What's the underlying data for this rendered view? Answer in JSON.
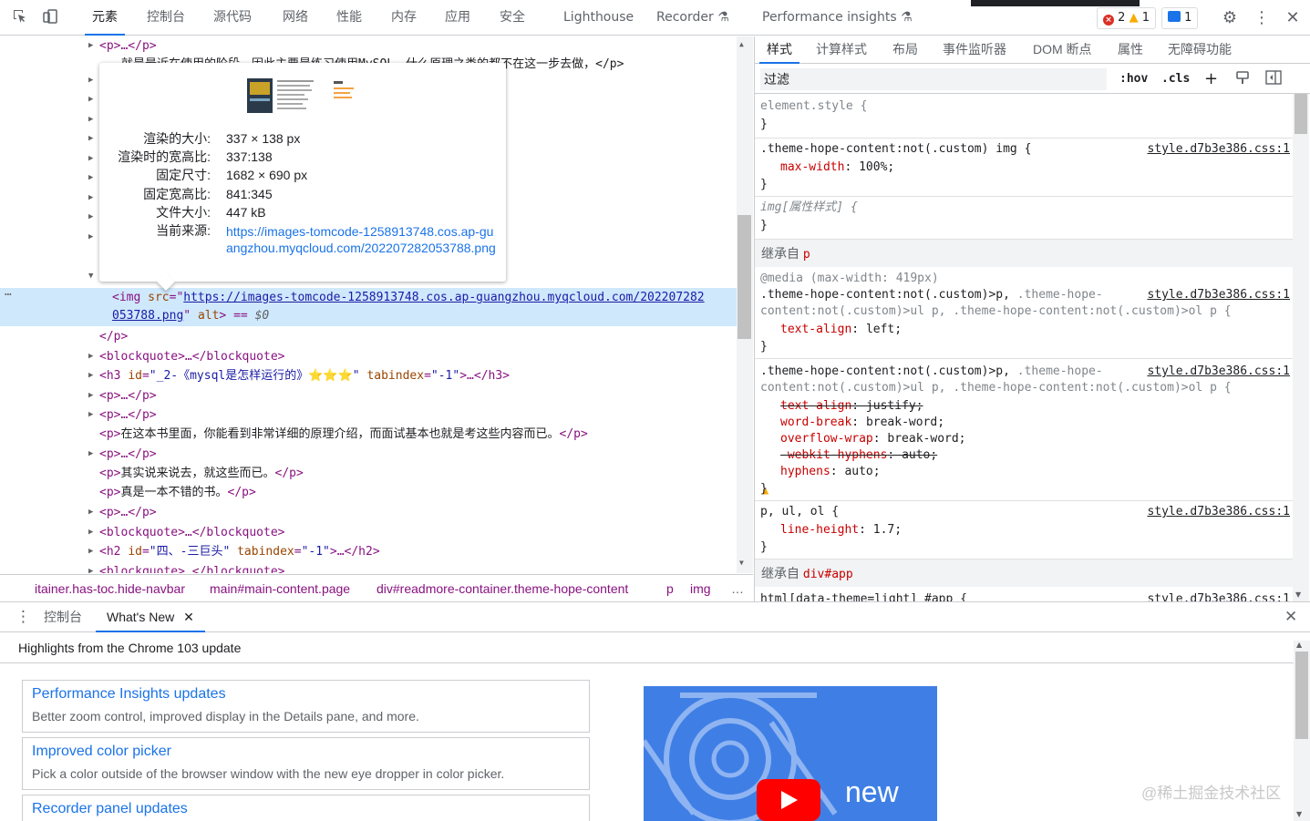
{
  "topbar": {
    "tabs": [
      "元素",
      "控制台",
      "源代码",
      "网络",
      "性能",
      "内存",
      "应用",
      "安全",
      "Lighthouse",
      "Recorder",
      "Performance insights"
    ],
    "errors": "2",
    "warnings": "1",
    "messages": "1"
  },
  "elements": {
    "lines": [
      "<p>…</p>",
      "就是最近在使用的阶段。因此主要是练习使用MySQL，什么原理之类的都不在这一步去做，</p>"
    ],
    "selected": {
      "tag_open": "<img",
      "attr_src": "src",
      "src_value_1": "https://images-tomcode-1258913748.cos.ap-guangzhou.myqcloud.com/202207282",
      "src_value_2": "053788.png",
      "attr_alt": "alt",
      "tail": "> == ",
      "var": "$0"
    },
    "after": [
      {
        "kind": "close",
        "text": "</p>"
      },
      {
        "kind": "collapsed",
        "text": "<blockquote>…</blockquote>"
      },
      {
        "kind": "h3",
        "tag": "<h3 ",
        "id_attr": "id",
        "id_val": "\"_2-《mysql是怎样运行的》⭐⭐⭐\"",
        "tab_attr": "tabindex",
        "tab_val": "\"-1\"",
        "tail": ">…</h3>"
      },
      {
        "kind": "collapsed",
        "text": "<p>…</p>"
      },
      {
        "kind": "collapsed",
        "text": "<p>…</p>"
      },
      {
        "kind": "p",
        "text": "在这本书里面，你能看到非常详细的原理介绍，而面试基本也就是考这些内容而已。"
      },
      {
        "kind": "collapsed",
        "text": "<p>…</p>"
      },
      {
        "kind": "p",
        "text": "其实说来说去，就这些而已。"
      },
      {
        "kind": "p",
        "text": "真是一本不错的书。"
      },
      {
        "kind": "collapsed",
        "text": "<p>…</p>"
      },
      {
        "kind": "collapsed",
        "text": "<blockquote>…</blockquote>"
      },
      {
        "kind": "h2",
        "tag": "<h2 ",
        "id_attr": "id",
        "id_val": "\"四、-三巨头\"",
        "tab_attr": "tabindex",
        "tab_val": "\"-1\"",
        "tail": ">…</h2>"
      },
      {
        "kind": "collapsed",
        "text": "<blockquote>…</blockquote>"
      }
    ]
  },
  "tooltip": {
    "rows": [
      {
        "k": "渲染的大小:",
        "v": "337 × 138 px"
      },
      {
        "k": "渲染时的宽高比:",
        "v": "337:138"
      },
      {
        "k": "固定尺寸:",
        "v": "1682 × 690 px"
      },
      {
        "k": "固定宽高比:",
        "v": "841:345"
      },
      {
        "k": "文件大小:",
        "v": "447 kB"
      },
      {
        "k": "当前来源:",
        "v": ""
      }
    ],
    "source_url": "https://images-tomcode-1258913748.cos.ap-guangzhou.myqcloud.com/202207282053788.png"
  },
  "breadcrumb": [
    "itainer.has-toc.hide-navbar",
    "main#main-content.page",
    "div#readmore-container.theme-hope-content",
    "p",
    "img",
    "…"
  ],
  "styles": {
    "subtabs": [
      "样式",
      "计算样式",
      "布局",
      "事件监听器",
      "DOM 断点",
      "属性",
      "无障碍功能"
    ],
    "filter_placeholder": "过滤",
    "hov": ":hov",
    "cls": ".cls",
    "element_style": "element.style {",
    "close": "}",
    "rule1_sel": ".theme-hope-content:not(.custom) img {",
    "rule1_prop": "max-width",
    "rule1_val": "100%;",
    "source": "style.d7b3e386.css:1",
    "attr_rule": "img[属性样式] {",
    "inherit_label": "继承自",
    "inherit_p": "p",
    "inherit_app": "div#app",
    "media": "@media (max-width: 419px)",
    "rule3_sel_a": ".theme-hope-content:not(.custom)>p,",
    "rule3_sel_b": ".theme-hope-",
    "rule3_sel_c": "content:not(.custom)>ul p, .theme-hope-content:not(.custom)>ol p {",
    "rule3_prop": "text-align",
    "rule3_val": "left;",
    "rule4_props": [
      {
        "name": "text-align",
        "val": "justify;",
        "struck": true
      },
      {
        "name": "word-break",
        "val": "break-word;",
        "struck": false
      },
      {
        "name": "overflow-wrap",
        "val": "break-word;",
        "struck": false
      },
      {
        "name": "-webkit-hyphens",
        "val": "auto;",
        "struck": true
      },
      {
        "name": "hyphens",
        "val": "auto;",
        "struck": false
      }
    ],
    "rule5_sel": "p, ul, ol {",
    "rule5_prop": "line-height",
    "rule5_val": "1.7;",
    "last_line": "html[data-theme=light] #app {"
  },
  "drawer": {
    "tabs": [
      "控制台",
      "What's New"
    ],
    "highlights": "Highlights from the Chrome 103 update",
    "cards": [
      {
        "title": "Performance Insights updates",
        "desc": "Better zoom control, improved display in the Details pane, and more."
      },
      {
        "title": "Improved color picker",
        "desc": "Pick a color outside of the browser window with the new eye dropper in color picker."
      },
      {
        "title": "Recorder panel updates",
        "desc": ""
      }
    ],
    "video_text": "new",
    "watermark": "@稀土掘金技术社区"
  }
}
